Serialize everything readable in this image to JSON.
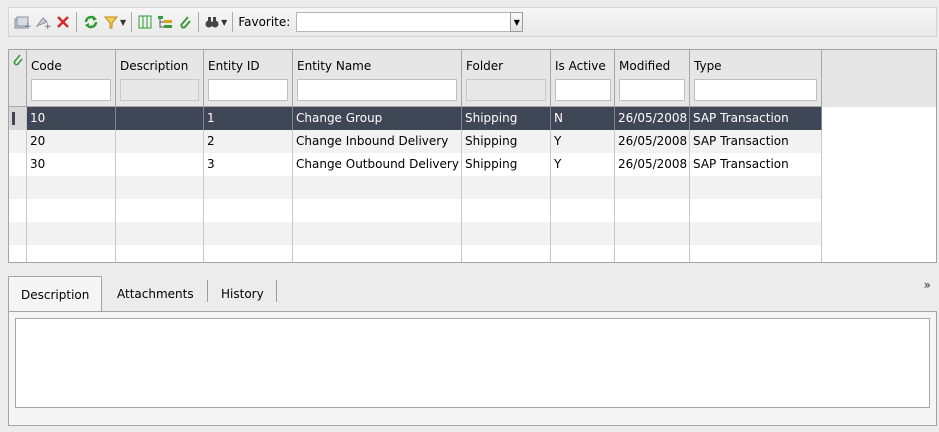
{
  "toolbar": {
    "favorite_label": "Favorite:",
    "favorite_value": "",
    "icons": [
      "new-entity-icon",
      "new-child-entity-icon",
      "delete-icon",
      "refresh-icon",
      "filter-icon",
      "select-columns-icon",
      "tree-view-icon",
      "attachment-icon",
      "find-icon"
    ],
    "colors": {
      "delete": "#D42B2B",
      "refresh": "#2E9C2E",
      "filter": "#D9A21A",
      "columns": "#2E9C2E",
      "attachment": "#3A9A3A"
    }
  },
  "grid": {
    "columns": [
      {
        "label": "Code",
        "filter": ""
      },
      {
        "label": "Description",
        "filter": ""
      },
      {
        "label": "Entity ID",
        "filter": ""
      },
      {
        "label": "Entity Name",
        "filter": ""
      },
      {
        "label": "Folder",
        "filter": ""
      },
      {
        "label": "Is Active",
        "filter": ""
      },
      {
        "label": "Modified",
        "filter": ""
      },
      {
        "label": "Type",
        "filter": ""
      }
    ],
    "rows": [
      {
        "code": "10",
        "description": "",
        "entity_id": "1",
        "entity_name": "Change Group",
        "folder": "Shipping",
        "is_active": "N",
        "modified": "26/05/2008",
        "type": "SAP Transaction",
        "selected": true
      },
      {
        "code": "20",
        "description": "",
        "entity_id": "2",
        "entity_name": "Change Inbound Delivery",
        "folder": "Shipping",
        "is_active": "Y",
        "modified": "26/05/2008",
        "type": "SAP Transaction",
        "selected": false
      },
      {
        "code": "30",
        "description": "",
        "entity_id": "3",
        "entity_name": "Change Outbound Delivery",
        "folder": "Shipping",
        "is_active": "Y",
        "modified": "26/05/2008",
        "type": "SAP Transaction",
        "selected": false
      }
    ],
    "selection_color": "#3F4656"
  },
  "tabs": [
    {
      "label": "Description",
      "active": true
    },
    {
      "label": "Attachments",
      "active": false
    },
    {
      "label": "History",
      "active": false
    }
  ],
  "description_text": ""
}
